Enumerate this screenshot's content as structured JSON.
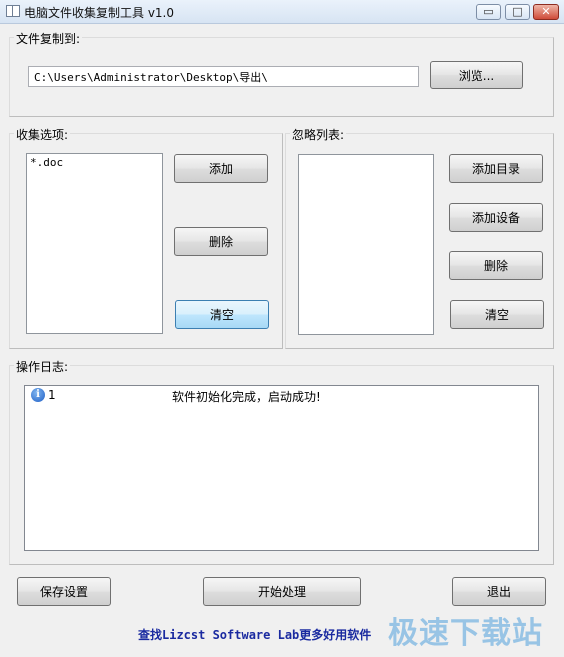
{
  "window": {
    "title": "电脑文件收集复制工具 v1.0",
    "minimize_glyph": "▭",
    "maximize_glyph": "□",
    "close_glyph": "✕"
  },
  "copy_to": {
    "label": "文件复制到:",
    "path_value": "C:\\Users\\Administrator\\Desktop\\导出\\",
    "browse_label": "浏览..."
  },
  "collect": {
    "label": "收集选项:",
    "items": [
      "*.doc"
    ],
    "add_label": "添加",
    "delete_label": "删除",
    "clear_label": "清空"
  },
  "ignore": {
    "label": "忽略列表:",
    "items": [],
    "add_dir_label": "添加目录",
    "add_device_label": "添加设备",
    "delete_label": "删除",
    "clear_label": "清空"
  },
  "log": {
    "label": "操作日志:",
    "entries": [
      {
        "index": "1",
        "message": "软件初始化完成，启动成功!",
        "icon": "info-icon"
      }
    ]
  },
  "actions": {
    "save_label": "保存设置",
    "start_label": "开始处理",
    "exit_label": "退出"
  },
  "footer": {
    "link_text": "查找Lizcst Software Lab更多好用软件"
  },
  "watermark": "极速下载站",
  "colors": {
    "window_bg": "#f0f0f0",
    "link": "#1a2aa0",
    "watermark": "#8fc0e4",
    "close_button": "#cf4b39"
  }
}
